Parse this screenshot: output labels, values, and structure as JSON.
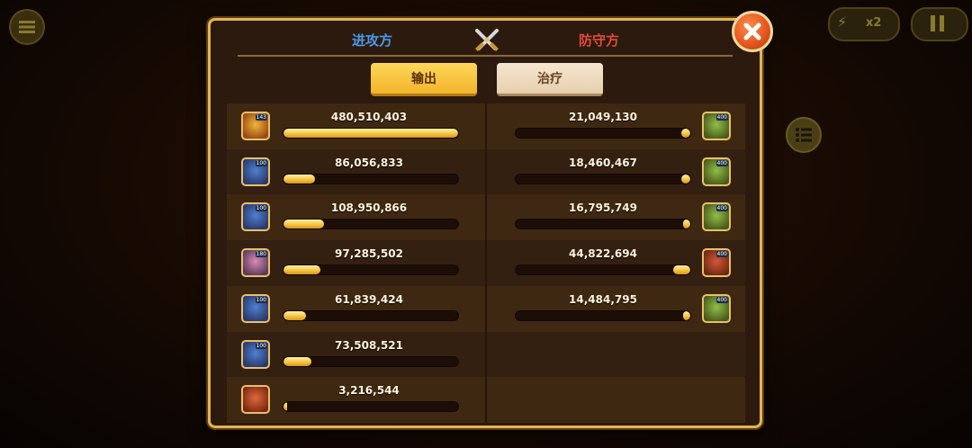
{
  "header": {
    "attacker_label": "进攻方",
    "defender_label": "防守方"
  },
  "tabs": [
    {
      "label": "输出",
      "active": true
    },
    {
      "label": "治疗",
      "active": false
    }
  ],
  "background": {
    "speed_label": "x2"
  },
  "colors": {
    "attacker": "#4a9ae8",
    "defender": "#e14b3a",
    "bar_fill": "#f3c03c",
    "frame": "#e2b453"
  },
  "attackers": [
    {
      "value": "480,510,403",
      "fraction": 1.0,
      "level": "143",
      "icon": "golden-warrior-portrait"
    },
    {
      "value": "86,056,833",
      "fraction": 0.18,
      "level": "100",
      "icon": "blue-knight-portrait"
    },
    {
      "value": "108,950,866",
      "fraction": 0.23,
      "level": "100",
      "icon": "blue-knight-portrait"
    },
    {
      "value": "97,285,502",
      "fraction": 0.21,
      "level": "180",
      "icon": "pink-rogue-portrait"
    },
    {
      "value": "61,839,424",
      "fraction": 0.13,
      "level": "100",
      "icon": "blue-knight-portrait"
    },
    {
      "value": "73,508,521",
      "fraction": 0.16,
      "level": "100",
      "icon": "blue-knight-portrait"
    },
    {
      "value": "3,216,544",
      "fraction": 0.01,
      "level": "",
      "icon": "fire-beast-portrait"
    }
  ],
  "defenders": [
    {
      "value": "21,049,130",
      "fraction": 0.05,
      "level": "400",
      "icon": "green-goblin-portrait"
    },
    {
      "value": "18,460,467",
      "fraction": 0.05,
      "level": "400",
      "icon": "green-goblin-portrait"
    },
    {
      "value": "16,795,749",
      "fraction": 0.04,
      "level": "400",
      "icon": "green-goblin-portrait"
    },
    {
      "value": "44,822,694",
      "fraction": 0.1,
      "level": "400",
      "icon": "red-goblin-portrait"
    },
    {
      "value": "14,484,795",
      "fraction": 0.04,
      "level": "400",
      "icon": "green-goblin-portrait"
    }
  ]
}
